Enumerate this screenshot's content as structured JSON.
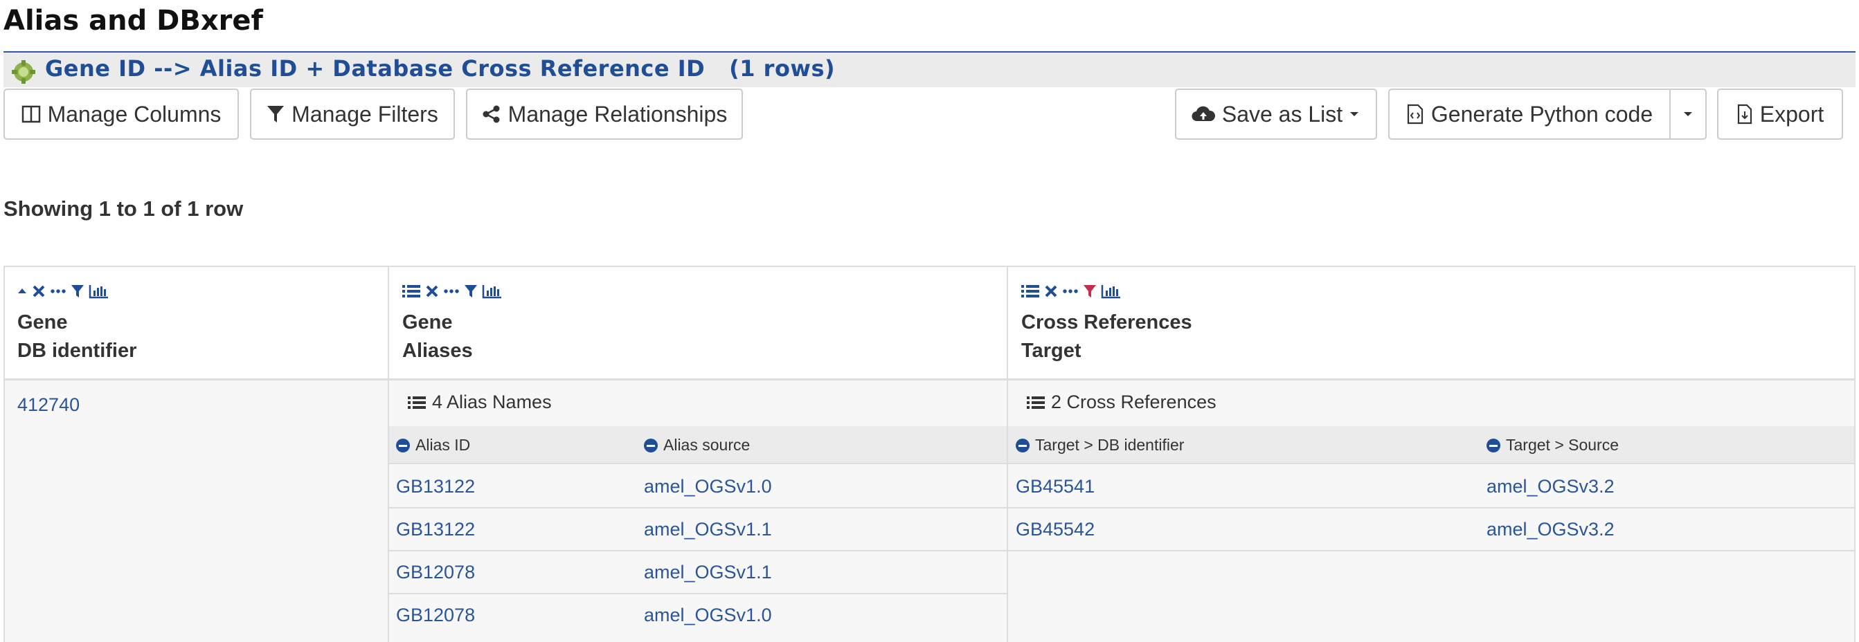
{
  "page": {
    "title": "Alias and DBxref"
  },
  "query": {
    "title": "Gene ID --> Alias ID + Database Cross Reference ID   (1 rows)"
  },
  "toolbar": {
    "manage_columns": "Manage Columns",
    "manage_filters": "Manage Filters",
    "manage_relationships": "Manage Relationships",
    "save_as_list": "Save as List",
    "generate_code": "Generate Python code",
    "export": "Export"
  },
  "summary": {
    "showing": "Showing 1 to 1 of 1 row"
  },
  "columns": [
    {
      "line1": "Gene",
      "line2": "DB identifier"
    },
    {
      "line1": "Gene",
      "line2": "Aliases"
    },
    {
      "line1": "Cross References",
      "line2": "Target"
    }
  ],
  "row": {
    "gene_id": "412740",
    "aliases": {
      "summary": "4 Alias Names",
      "headers": [
        "Alias ID",
        "Alias source"
      ],
      "rows": [
        [
          "GB13122",
          "amel_OGSv1.0"
        ],
        [
          "GB13122",
          "amel_OGSv1.1"
        ],
        [
          "GB12078",
          "amel_OGSv1.1"
        ],
        [
          "GB12078",
          "amel_OGSv1.0"
        ]
      ]
    },
    "xrefs": {
      "summary": "2 Cross References",
      "headers": [
        "Target > DB identifier",
        "Target > Source"
      ],
      "rows": [
        [
          "GB45541",
          "amel_OGSv3.2"
        ],
        [
          "GB45542",
          "amel_OGSv3.2"
        ]
      ]
    }
  },
  "colors": {
    "link": "#2a5599",
    "accent": "#1f4e96",
    "filter_active": "#c0304a"
  }
}
